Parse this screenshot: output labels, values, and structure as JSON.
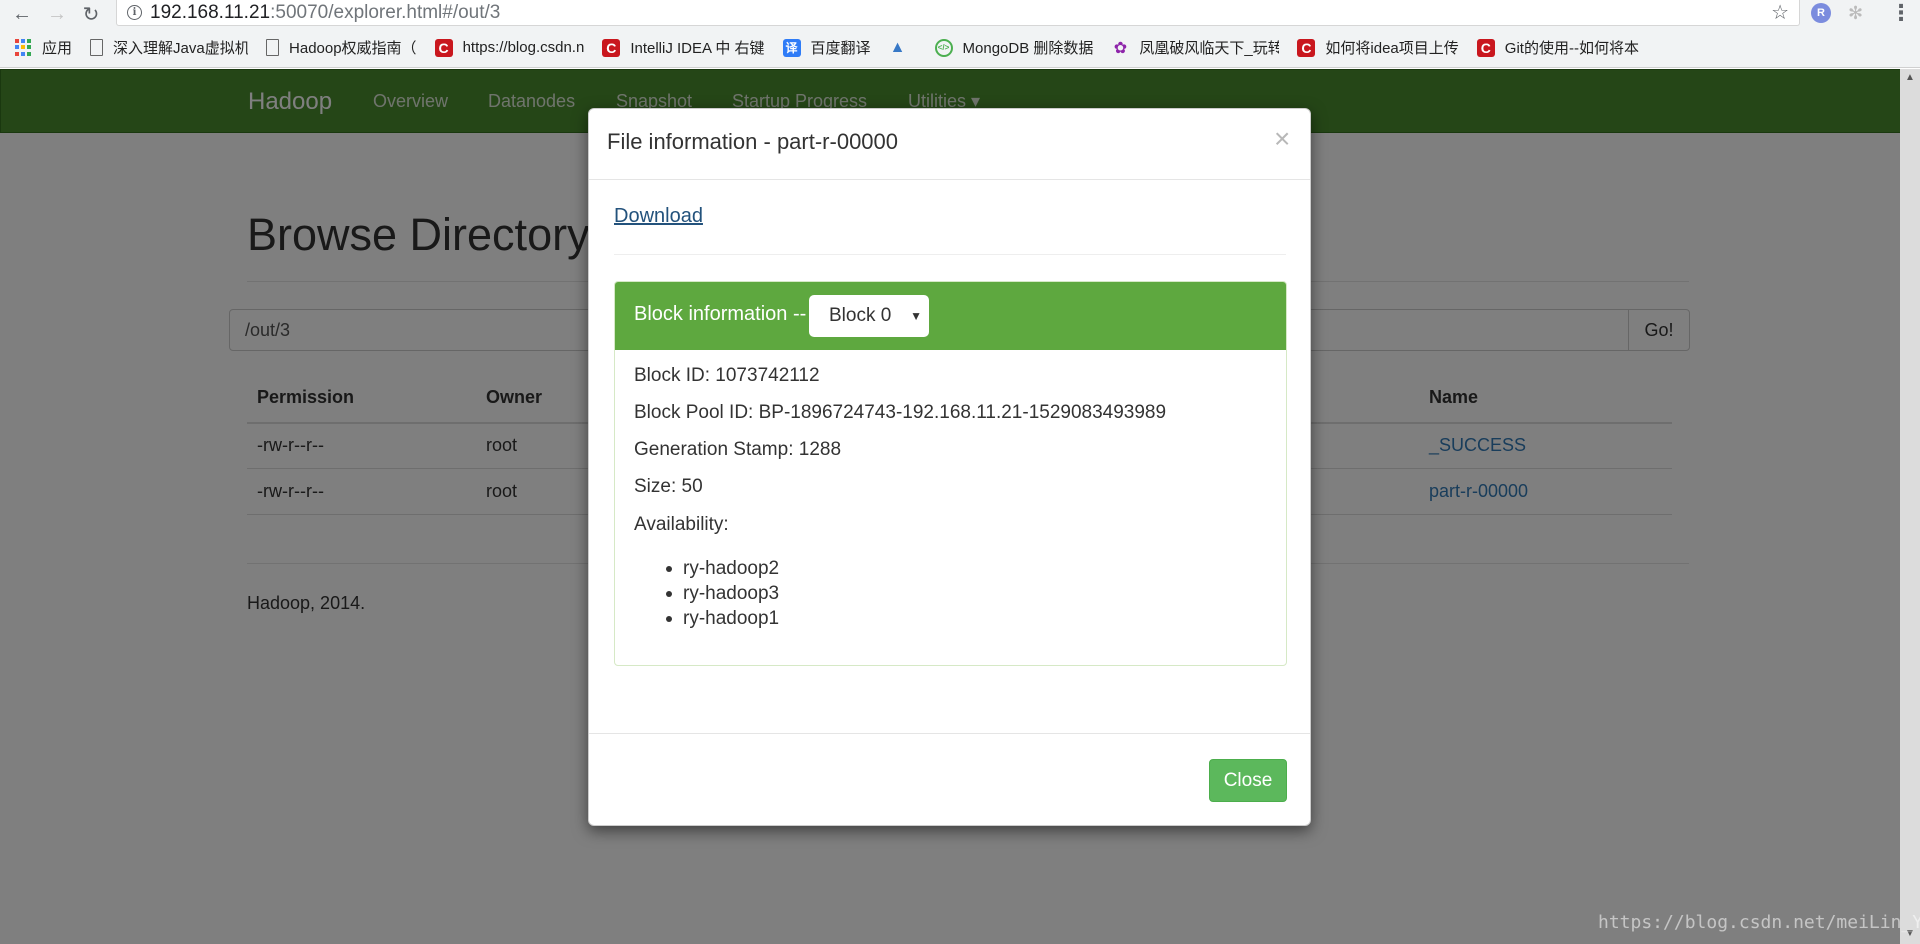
{
  "browser": {
    "url_host": "192.168.11.21",
    "url_path": ":50070/explorer.html#/out/3",
    "extension_badge": "R",
    "bookmarks": [
      {
        "label": "应用",
        "icon": "apps-grid-icon"
      },
      {
        "label": "深入理解Java虚拟机",
        "icon": "document-icon"
      },
      {
        "label": "Hadoop权威指南（",
        "icon": "document-icon"
      },
      {
        "label": "https://blog.csdn.n",
        "icon": "csdn-icon"
      },
      {
        "label": "IntelliJ IDEA 中 右键",
        "icon": "csdn-icon"
      },
      {
        "label": "百度翻译",
        "icon": "translate-icon"
      },
      {
        "label": "",
        "icon": "triangle-icon"
      },
      {
        "label": "MongoDB 删除数据",
        "icon": "mongodb-icon"
      },
      {
        "label": "凤凰破风临天下_玩转",
        "icon": "bird-icon"
      },
      {
        "label": "如何将idea项目上传",
        "icon": "csdn-icon"
      },
      {
        "label": "Git的使用--如何将本",
        "icon": "csdn-icon"
      }
    ]
  },
  "navbar": {
    "brand": "Hadoop",
    "links": [
      "Overview",
      "Datanodes",
      "Snapshot",
      "Startup Progress",
      "Utilities ▾"
    ]
  },
  "main": {
    "title": "Browse Directory",
    "path_value": "/out/3",
    "go_label": "Go!",
    "columns": {
      "permission": "Permission",
      "owner": "Owner",
      "name": "Name"
    },
    "rows": [
      {
        "permission": "-rw-r--r--",
        "owner": "root",
        "name": "_SUCCESS"
      },
      {
        "permission": "-rw-r--r--",
        "owner": "root",
        "name": "part-r-00000"
      }
    ],
    "footer": "Hadoop, 2014."
  },
  "modal": {
    "title": "File information - part-r-00000",
    "close_x": "×",
    "download_label": "Download",
    "block_info_label": "Block information --",
    "block_selected": "Block 0",
    "block_id": "Block ID: 1073742112",
    "block_pool_id": "Block Pool ID: BP-1896724743-192.168.11.21-1529083493989",
    "generation_stamp": "Generation Stamp: 1288",
    "size": "Size: 50",
    "availability_label": "Availability:",
    "availability": [
      "ry-hadoop2",
      "ry-hadoop3",
      "ry-hadoop1"
    ],
    "close_label": "Close"
  },
  "watermark": "https://blog.csdn.net/meiLin_Ya",
  "colors": {
    "navbar": "#4a8c2f",
    "panel_heading": "#5ea83f",
    "close_button": "#5cb85c",
    "link": "#337ab7"
  }
}
